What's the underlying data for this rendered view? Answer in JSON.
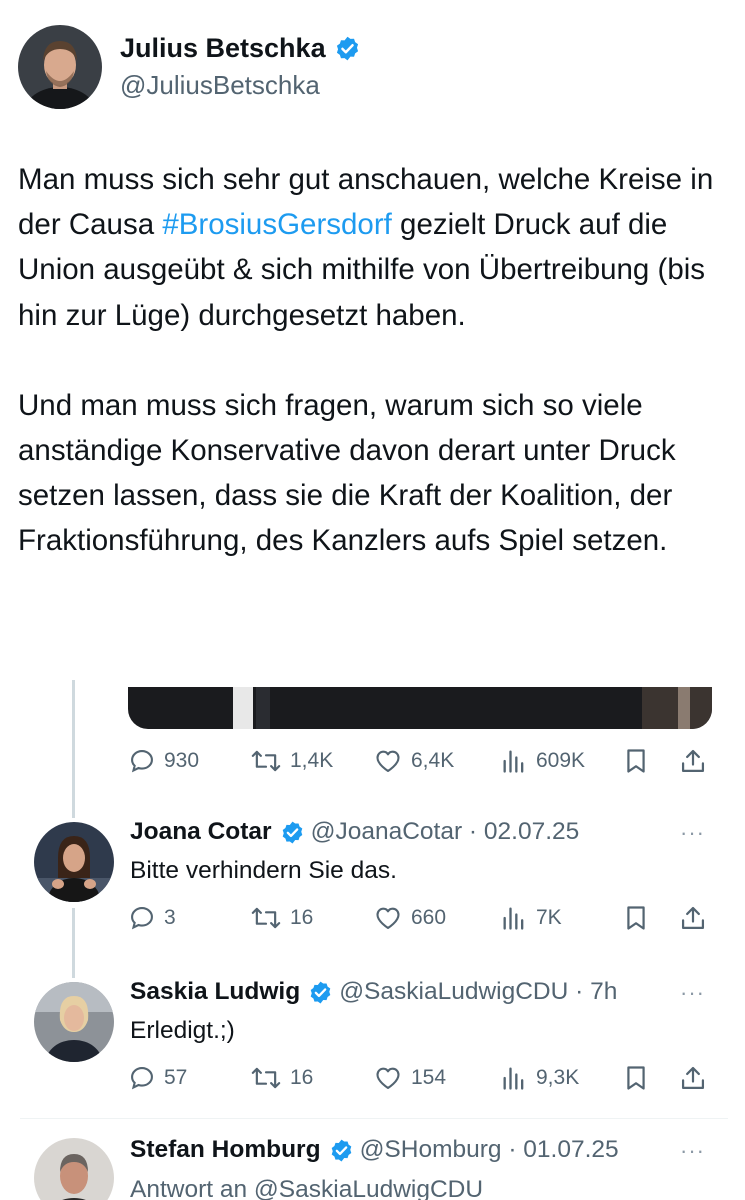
{
  "author": {
    "name": "Julius Betschka",
    "handle": "@JuliusBetschka"
  },
  "tweet": {
    "p1_before": "Man muss sich sehr gut anschauen, welche Kreise in der Causa ",
    "hashtag": "#BrosiusGersdorf",
    "p1_after": " gezielt Druck auf die Union ausgeübt & sich mithilfe von Übertreibung (bis hin zur Lüge) durchgesetzt haben.",
    "p2": "Und man muss sich fragen, warum sich so viele anständige Konservative davon derart unter Druck setzen lassen, dass sie die Kraft der Koalition, der Fraktionsführung, des Kanzlers aufs Spiel setzen."
  },
  "main_stats": {
    "replies": "930",
    "reposts": "1,4K",
    "likes": "6,4K",
    "views": "609K"
  },
  "replies": [
    {
      "name": "Joana Cotar",
      "handle_time": "@JoanaCotar · 02.07.25",
      "text": "Bitte verhindern Sie das.",
      "stats": {
        "replies": "3",
        "reposts": "16",
        "likes": "660",
        "views": "7K"
      }
    },
    {
      "name": "Saskia Ludwig",
      "handle_time": "@SaskiaLudwigCDU · 7h",
      "text": "Erledigt.;)",
      "stats": {
        "replies": "57",
        "reposts": "16",
        "likes": "154",
        "views": "9,3K"
      }
    },
    {
      "name": "Stefan Homburg",
      "handle_time": "@SHomburg · 01.07.25",
      "text": "Antwort an @SaskiaLudwigCDU"
    }
  ],
  "ui": {
    "more": "···"
  },
  "colors": {
    "accent": "#1d9bf0",
    "secondary_text": "#536471",
    "verified": "#1d9bf0"
  }
}
